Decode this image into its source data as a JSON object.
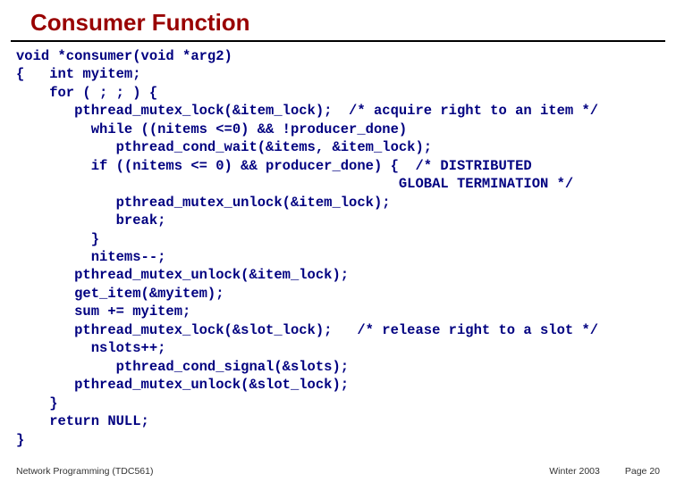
{
  "title": "Consumer Function",
  "code": {
    "l01": "void *consumer(void *arg2)",
    "l02": "{   int myitem;",
    "l03": "    for ( ; ; ) {",
    "l04": "       pthread_mutex_lock(&item_lock);  /* acquire right to an item */",
    "l05": "         while ((nitems <=0) && !producer_done)",
    "l06": "            pthread_cond_wait(&items, &item_lock);",
    "l07": "         if ((nitems <= 0) && producer_done) {  /* DISTRIBUTED",
    "l08": "                                              GLOBAL TERMINATION */",
    "l09": "            pthread_mutex_unlock(&item_lock);",
    "l10": "            break;",
    "l11": "         }",
    "l12": "         nitems--;",
    "l13": "       pthread_mutex_unlock(&item_lock);",
    "l14": "       get_item(&myitem);",
    "l15": "       sum += myitem;",
    "l16": "       pthread_mutex_lock(&slot_lock);   /* release right to a slot */",
    "l17": "         nslots++;",
    "l18": "            pthread_cond_signal(&slots);",
    "l19": "       pthread_mutex_unlock(&slot_lock);",
    "l20": "    }",
    "l21": "    return NULL;",
    "l22": "}"
  },
  "footer": {
    "left": "Network Programming (TDC561)",
    "center": "Winter 2003",
    "right": "Page 20"
  }
}
